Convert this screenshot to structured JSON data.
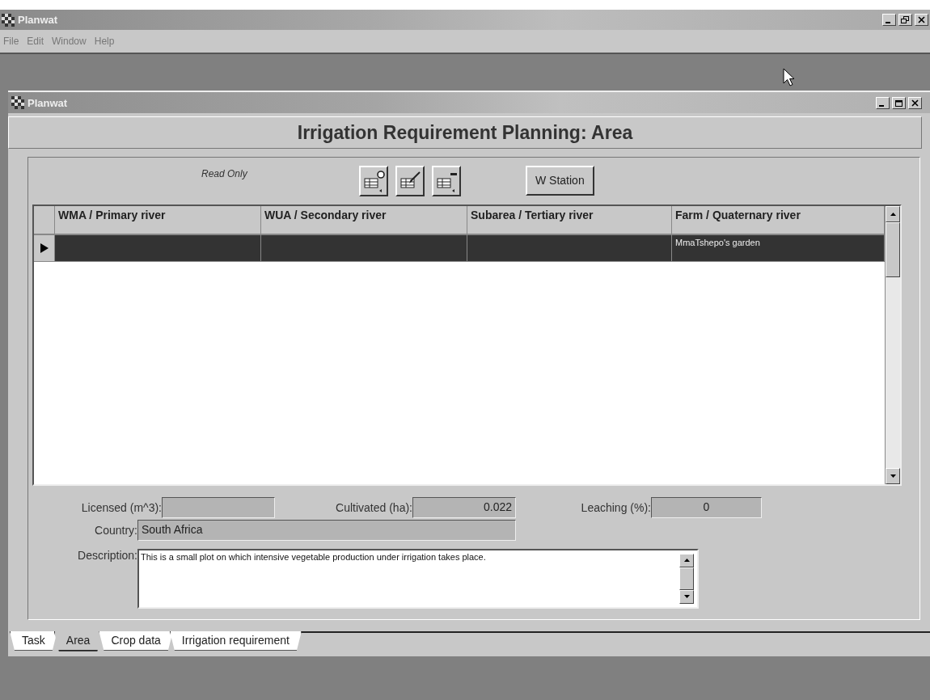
{
  "app_window": {
    "title": "Planwat",
    "menu": [
      "File",
      "Edit",
      "Window",
      "Help"
    ]
  },
  "document_window": {
    "title": "Planwat"
  },
  "heading": "Irrigation Requirement Planning: Area",
  "toolbar": {
    "status": "Read Only",
    "buttons": [
      {
        "kind": "add-row"
      },
      {
        "kind": "edit-row"
      },
      {
        "kind": "delete-row"
      },
      {
        "kind": "text",
        "label": "W Station"
      }
    ]
  },
  "table": {
    "columns": [
      "WMA / Primary river",
      "WUA / Secondary river",
      "Subarea / Tertiary river",
      "Farm / Quaternary river"
    ],
    "rows": [
      {
        "selected": true,
        "farm": "MmaTshepo's garden"
      }
    ]
  },
  "licensed": {
    "label": "Licensed (m^3):"
  },
  "cultivated": {
    "label": "Cultivated (ha):",
    "value": "0.022"
  },
  "leaching": {
    "label": "Leaching (%):",
    "value": "0"
  },
  "country": {
    "label": "Country:",
    "value": "South Africa"
  },
  "description": {
    "label": "Description:",
    "value": "This is a small plot on which intensive vegetable production under irrigation takes place."
  },
  "tabs": [
    {
      "label": "Task",
      "selected": false
    },
    {
      "label": "Area",
      "selected": true
    },
    {
      "label": "Crop data",
      "selected": false
    },
    {
      "label": "Irrigation requirement",
      "selected": false
    }
  ]
}
